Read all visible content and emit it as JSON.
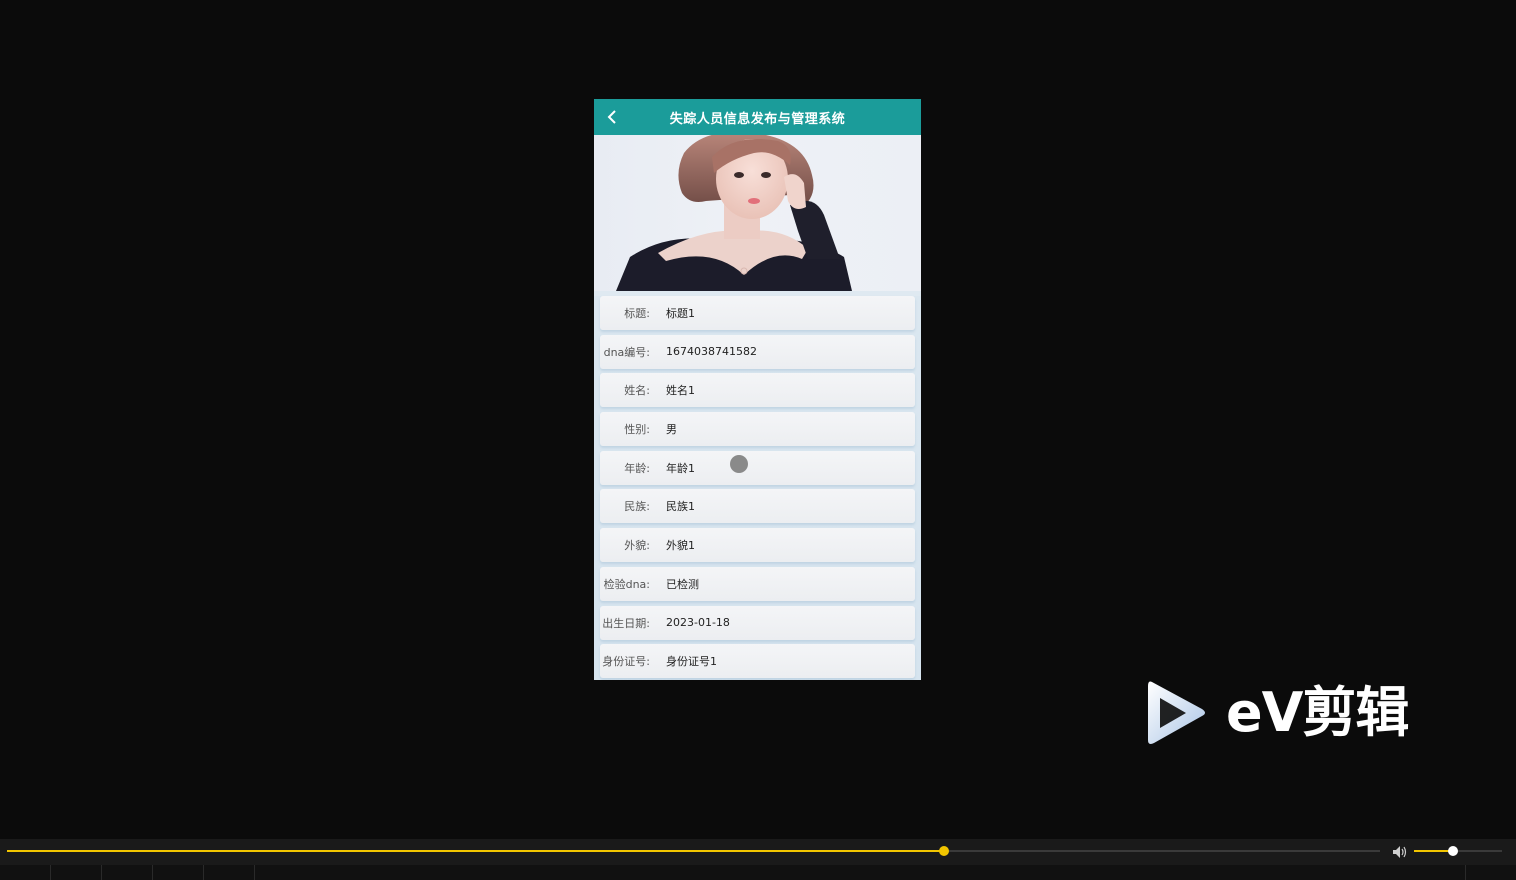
{
  "app": {
    "title": "失踪人员信息发布与管理系统"
  },
  "icons": {
    "back": "chevron-left-icon",
    "volume": "speaker-icon",
    "watermark": "play-logo-icon"
  },
  "colors": {
    "header": "#1b9c9a",
    "accent": "#f2c500"
  },
  "details": [
    {
      "label": "标题:",
      "value": "标题1"
    },
    {
      "label": "dna编号:",
      "value": "1674038741582"
    },
    {
      "label": "姓名:",
      "value": "姓名1"
    },
    {
      "label": "性别:",
      "value": "男"
    },
    {
      "label": "年龄:",
      "value": "年龄1"
    },
    {
      "label": "民族:",
      "value": "民族1"
    },
    {
      "label": "外貌:",
      "value": "外貌1"
    },
    {
      "label": "检验dna:",
      "value": "已检测"
    },
    {
      "label": "出生日期:",
      "value": "2023-01-18"
    },
    {
      "label": "身份证号:",
      "value": "身份证号1"
    }
  ],
  "watermark": {
    "text": "eV剪辑"
  },
  "player": {
    "progress": 0.6825,
    "volume": 0.44
  }
}
